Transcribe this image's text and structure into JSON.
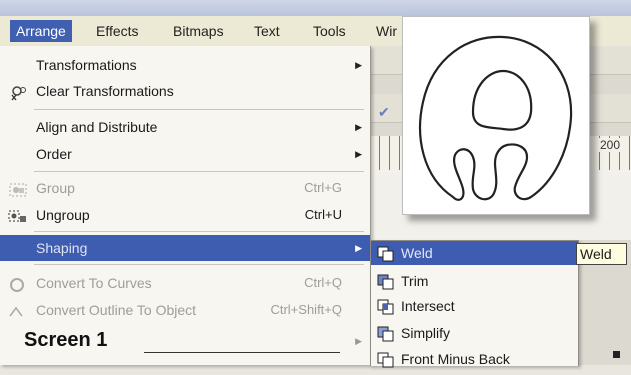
{
  "menubar": {
    "items": [
      {
        "label": "Arrange",
        "active": true
      },
      {
        "label": "Effects",
        "active": false
      },
      {
        "label": "Bitmaps",
        "active": false
      },
      {
        "label": "Text",
        "active": false
      },
      {
        "label": "Tools",
        "active": false
      },
      {
        "label": "Wir",
        "active": false
      }
    ]
  },
  "ruler": {
    "label": "200"
  },
  "arrange_menu": {
    "items": [
      {
        "label": "Transformations",
        "has_submenu": true
      },
      {
        "label": "Clear Transformations",
        "icon": "clear-transformations-icon"
      },
      {
        "label": "Align and Distribute",
        "has_submenu": true
      },
      {
        "label": "Order",
        "has_submenu": true
      },
      {
        "label": "Group",
        "shortcut": "Ctrl+G",
        "disabled": true,
        "icon": "group-icon"
      },
      {
        "label": "Ungroup",
        "shortcut": "Ctrl+U",
        "icon": "ungroup-icon"
      },
      {
        "label": "Shaping",
        "has_submenu": true,
        "highlighted": true
      },
      {
        "label": "Convert To Curves",
        "shortcut": "Ctrl+Q",
        "disabled": true,
        "icon": "convert-curves-icon"
      },
      {
        "label": "Convert Outline To Object",
        "shortcut": "Ctrl+Shift+Q",
        "disabled": true,
        "icon": "convert-outline-icon"
      }
    ]
  },
  "shaping_submenu": {
    "items": [
      {
        "label": "Weld",
        "highlighted": true,
        "icon": "weld-icon"
      },
      {
        "label": "Trim",
        "icon": "trim-icon"
      },
      {
        "label": "Intersect",
        "icon": "intersect-icon"
      },
      {
        "label": "Simplify",
        "icon": "simplify-icon"
      },
      {
        "label": "Front Minus Back",
        "icon": "front-minus-back-icon"
      }
    ]
  },
  "tooltip": {
    "text": "Weld"
  },
  "caption": {
    "text": "Screen 1"
  },
  "colors": {
    "highlight": "#3e5cb0",
    "menu_bg": "#f7f6f1",
    "tooltip_bg": "#fffde0"
  }
}
